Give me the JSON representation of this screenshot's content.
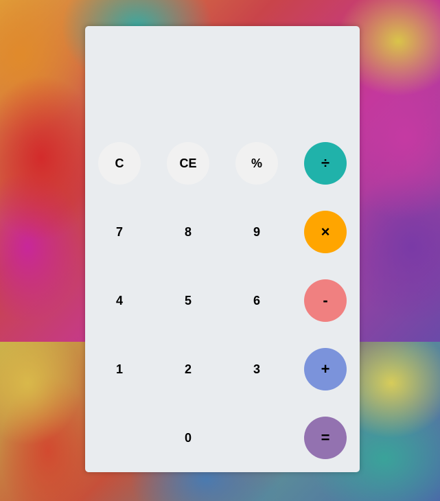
{
  "display": {
    "value": ""
  },
  "keys": {
    "clear": "C",
    "clear_entry": "CE",
    "percent": "%",
    "divide": "÷",
    "seven": "7",
    "eight": "8",
    "nine": "9",
    "multiply": "×",
    "four": "4",
    "five": "5",
    "six": "6",
    "subtract": "-",
    "one": "1",
    "two": "2",
    "three": "3",
    "add": "+",
    "zero": "0",
    "equals": "="
  },
  "colors": {
    "panel": "#e9ecef",
    "function_key": "#f1f1f1",
    "divide": "#20b2aa",
    "multiply": "#ffa500",
    "subtract": "#f08080",
    "add": "#7b93db",
    "equals": "#9372b0"
  }
}
